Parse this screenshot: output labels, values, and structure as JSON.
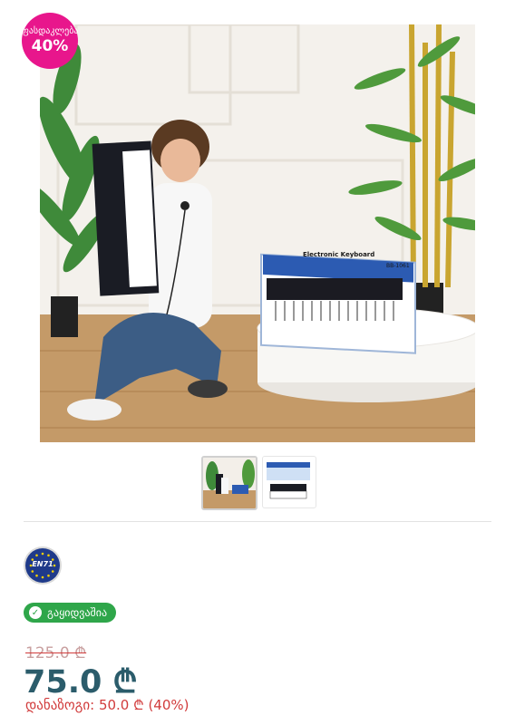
{
  "badge": {
    "label": "ფასდაკლება",
    "percent": "40%"
  },
  "product_image": {
    "box_title": "Electronic Keyboard",
    "box_model": "BB-1061"
  },
  "thumbnails": [
    {
      "name": "thumbnail-1",
      "selected": true
    },
    {
      "name": "thumbnail-2",
      "selected": false
    }
  ],
  "certification": {
    "label": "EN71"
  },
  "stock": {
    "label": "გაყიდვაშია"
  },
  "pricing": {
    "old_price": "125.0 ₾",
    "current_price": "75.0 ₾",
    "savings": "დანაზოგი: 50.0 ₾ (40%)"
  }
}
